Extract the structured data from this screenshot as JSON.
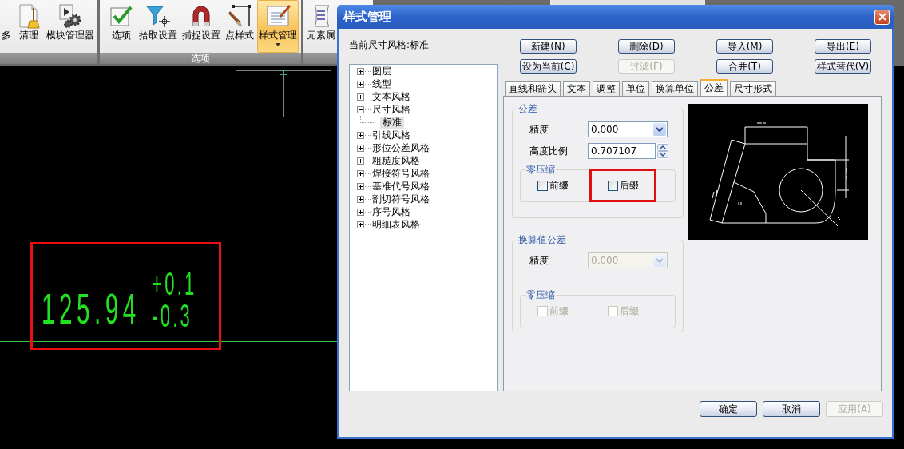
{
  "ribbon": {
    "groups": [
      {
        "buttons": [
          {
            "label": "多",
            "kind": "none",
            "selected": false,
            "has_menu": false
          },
          {
            "label": "清理",
            "kind": "purge",
            "selected": false,
            "has_menu": false
          },
          {
            "label": "模块管理器",
            "kind": "modules",
            "selected": false,
            "has_menu": false
          }
        ]
      },
      {
        "label": "选项",
        "buttons": [
          {
            "label": "选项",
            "kind": "options",
            "selected": false,
            "has_menu": false
          },
          {
            "label": "拾取设置",
            "kind": "pick",
            "selected": false,
            "has_menu": false
          },
          {
            "label": "捕捉设置",
            "kind": "snap",
            "selected": false,
            "has_menu": false
          },
          {
            "label": "点样式",
            "kind": "point",
            "selected": false,
            "has_menu": false
          },
          {
            "label": "样式管理",
            "kind": "style",
            "selected": true,
            "has_menu": true
          }
        ]
      },
      {
        "buttons": [
          {
            "label": "元素属",
            "kind": "scroll",
            "selected": false,
            "has_menu": false
          }
        ]
      }
    ]
  },
  "canvas": {
    "dimension": {
      "value": "125.94",
      "upper": "+0.1",
      "lower": "-0.3",
      "highlighted": true
    }
  },
  "dialog": {
    "title": "样式管理",
    "current_style": "当前尺寸风格:标准",
    "buttons": [
      {
        "label": "新建(N)",
        "disabled": false
      },
      {
        "label": "删除(D)",
        "disabled": false
      },
      {
        "label": "导入(M)",
        "disabled": false
      },
      {
        "label": "导出(E)",
        "disabled": false
      },
      {
        "label": "设为当前(C)",
        "disabled": false
      },
      {
        "label": "过滤(F)",
        "disabled": true
      },
      {
        "label": "合并(T)",
        "disabled": false
      },
      {
        "label": "样式替代(V)",
        "disabled": false
      }
    ],
    "tree": [
      {
        "label": "图层",
        "expanded": false
      },
      {
        "label": "线型",
        "expanded": false
      },
      {
        "label": "文本风格",
        "expanded": false
      },
      {
        "label": "尺寸风格",
        "expanded": true,
        "children": [
          {
            "label": "标准",
            "selected": true
          }
        ]
      },
      {
        "label": "引线风格",
        "expanded": false
      },
      {
        "label": "形位公差风格",
        "expanded": false
      },
      {
        "label": "粗糙度风格",
        "expanded": false
      },
      {
        "label": "焊接符号风格",
        "expanded": false
      },
      {
        "label": "基准代号风格",
        "expanded": false
      },
      {
        "label": "剖切符号风格",
        "expanded": false
      },
      {
        "label": "序号风格",
        "expanded": false
      },
      {
        "label": "明细表风格",
        "expanded": false
      }
    ],
    "tabs": [
      {
        "label": "直线和箭头",
        "selected": false
      },
      {
        "label": "文本",
        "selected": false
      },
      {
        "label": "调整",
        "selected": false
      },
      {
        "label": "单位",
        "selected": false
      },
      {
        "label": "换算单位",
        "selected": false
      },
      {
        "label": "公差",
        "selected": true
      },
      {
        "label": "尺寸形式",
        "selected": false
      }
    ],
    "tolerance": {
      "title": "公差",
      "disabled": false,
      "precision": {
        "label": "精度",
        "value": "0.000"
      },
      "height_ratio": {
        "label": "高度比例",
        "value": "0.707107"
      },
      "zero_suppression": {
        "title": "零压缩",
        "options": [
          {
            "label": "前缀",
            "checked": false,
            "highlighted": false
          },
          {
            "label": "后缀",
            "checked": false,
            "highlighted": true
          }
        ]
      }
    },
    "alt_tolerance": {
      "title": "换算值公差",
      "disabled": true,
      "precision": {
        "label": "精度",
        "value": "0.000"
      },
      "zero_suppression": {
        "title": "零压缩",
        "options": [
          {
            "label": "前缀",
            "checked": false,
            "highlighted": false
          },
          {
            "label": "后缀",
            "checked": false,
            "highlighted": false
          }
        ]
      }
    },
    "footer_buttons": [
      {
        "label": "确定",
        "disabled": false
      },
      {
        "label": "取消",
        "disabled": false
      },
      {
        "label": "应用(A)",
        "disabled": true
      }
    ]
  }
}
